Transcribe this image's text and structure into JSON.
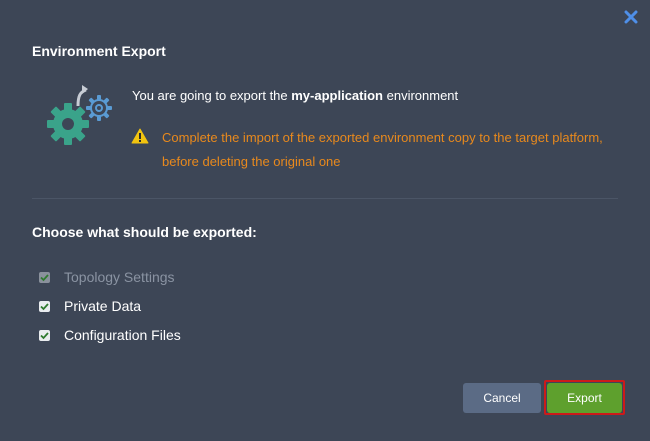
{
  "dialog": {
    "title": "Environment Export",
    "message_prefix": "You are going to export the ",
    "environment_name": "my-application",
    "message_suffix": " environment",
    "warning": "Complete the import of the exported environment copy to the target platform, before deleting the original one",
    "section_title": "Choose what should be exported:",
    "options": [
      {
        "label": "Topology Settings",
        "checked": true,
        "disabled": true
      },
      {
        "label": "Private Data",
        "checked": true,
        "disabled": false
      },
      {
        "label": "Configuration Files",
        "checked": true,
        "disabled": false
      }
    ],
    "cancel_label": "Cancel",
    "export_label": "Export"
  },
  "icons": {
    "close": "close-icon",
    "gears": "gears-export-icon",
    "warning": "warning-icon",
    "check": "check-icon"
  },
  "colors": {
    "background": "#3d4656",
    "warning_text": "#e8891d",
    "export_button": "#5ea02d",
    "cancel_button": "#5b6b85",
    "gear_green": "#3aa38a",
    "gear_blue": "#5a9bd4",
    "highlight_outline": "#cc1a1a"
  }
}
